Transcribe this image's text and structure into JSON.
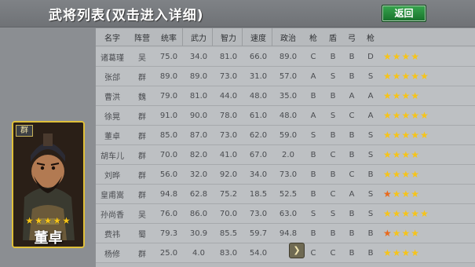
{
  "title": "武将列表(双击进入详细)",
  "back_label": "返回",
  "selected_general": {
    "name": "董卓",
    "faction": "群",
    "stars": 5
  },
  "columns": [
    "名字",
    "阵营",
    "统率",
    "武力",
    "智力",
    "速度",
    "政治",
    "枪",
    "盾",
    "弓",
    "枪"
  ],
  "rows": [
    {
      "name": "诸葛瑾",
      "faction": "吴",
      "lead": "75.0",
      "war": "34.0",
      "int": "81.0",
      "spd": "66.0",
      "pol": "89.0",
      "a": "C",
      "b": "B",
      "c": "B",
      "d": "D",
      "stars": 4,
      "orange": 0
    },
    {
      "name": "张郃",
      "faction": "群",
      "lead": "89.0",
      "war": "89.0",
      "int": "73.0",
      "spd": "31.0",
      "pol": "57.0",
      "a": "A",
      "b": "S",
      "c": "B",
      "d": "S",
      "stars": 5,
      "orange": 0
    },
    {
      "name": "曹洪",
      "faction": "魏",
      "lead": "79.0",
      "war": "81.0",
      "int": "44.0",
      "spd": "48.0",
      "pol": "35.0",
      "a": "B",
      "b": "B",
      "c": "A",
      "d": "A",
      "stars": 4,
      "orange": 0
    },
    {
      "name": "徐晃",
      "faction": "群",
      "lead": "91.0",
      "war": "90.0",
      "int": "78.0",
      "spd": "61.0",
      "pol": "48.0",
      "a": "A",
      "b": "S",
      "c": "C",
      "d": "A",
      "stars": 5,
      "orange": 0
    },
    {
      "name": "董卓",
      "faction": "群",
      "lead": "85.0",
      "war": "87.0",
      "int": "73.0",
      "spd": "62.0",
      "pol": "59.0",
      "a": "S",
      "b": "B",
      "c": "B",
      "d": "S",
      "stars": 5,
      "orange": 0
    },
    {
      "name": "胡车儿",
      "faction": "群",
      "lead": "70.0",
      "war": "82.0",
      "int": "41.0",
      "spd": "67.0",
      "pol": "2.0",
      "a": "B",
      "b": "C",
      "c": "B",
      "d": "S",
      "stars": 4,
      "orange": 0
    },
    {
      "name": "刘晔",
      "faction": "群",
      "lead": "56.0",
      "war": "32.0",
      "int": "92.0",
      "spd": "34.0",
      "pol": "73.0",
      "a": "B",
      "b": "B",
      "c": "C",
      "d": "B",
      "stars": 4,
      "orange": 0
    },
    {
      "name": "皇甫嵩",
      "faction": "群",
      "lead": "94.8",
      "war": "62.8",
      "int": "75.2",
      "spd": "18.5",
      "pol": "52.5",
      "a": "B",
      "b": "C",
      "c": "A",
      "d": "S",
      "stars": 4,
      "orange": 1
    },
    {
      "name": "孙尚香",
      "faction": "吴",
      "lead": "76.0",
      "war": "86.0",
      "int": "70.0",
      "spd": "73.0",
      "pol": "63.0",
      "a": "S",
      "b": "S",
      "c": "B",
      "d": "S",
      "stars": 5,
      "orange": 0
    },
    {
      "name": "费祎",
      "faction": "蜀",
      "lead": "79.3",
      "war": "30.9",
      "int": "85.5",
      "spd": "59.7",
      "pol": "94.8",
      "a": "B",
      "b": "B",
      "c": "B",
      "d": "B",
      "stars": 4,
      "orange": 1
    },
    {
      "name": "杨修",
      "faction": "群",
      "lead": "25.0",
      "war": "4.0",
      "int": "83.0",
      "spd": "54.0",
      "pol": "",
      "a": "C",
      "b": "C",
      "c": "B",
      "d": "B",
      "stars": 4,
      "orange": 0
    }
  ],
  "icons": {
    "star": "star-icon",
    "next": "chevron-right-icon"
  },
  "colors": {
    "star_gold": "#f6c419",
    "star_orange": "#e86a1c",
    "back_button": "#1f8a38",
    "card_border": "#e0c03a"
  }
}
